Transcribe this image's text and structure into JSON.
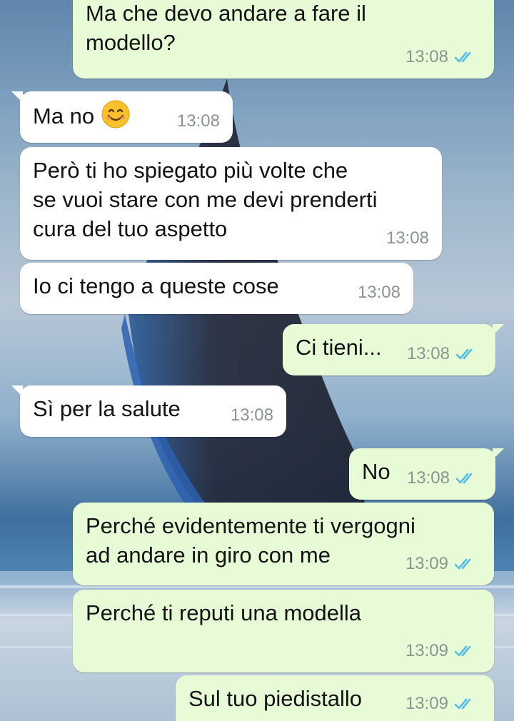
{
  "colors": {
    "outgoing_bubble": "#e7fcd6",
    "incoming_bubble": "#ffffff",
    "read_ticks": "#53bdeb",
    "time_text": "#8a958f"
  },
  "messages": [
    {
      "direction": "outgoing",
      "text": "Ma che devo andare a fare il\nmodello?",
      "time": "13:08",
      "status_icon": "double-check-read-icon"
    },
    {
      "direction": "incoming",
      "text": "Ma no",
      "emoji": "smiling-face-emoji",
      "time": "13:08"
    },
    {
      "direction": "incoming",
      "text": "Però ti ho spiegato più volte che\nse vuoi stare con me devi prenderti\ncura del tuo aspetto",
      "time": "13:08"
    },
    {
      "direction": "incoming",
      "text": "Io ci tengo a queste cose",
      "time": "13:08"
    },
    {
      "direction": "outgoing",
      "text": "Ci tieni...",
      "time": "13:08",
      "status_icon": "double-check-read-icon"
    },
    {
      "direction": "incoming",
      "text": "Sì per la salute",
      "time": "13:08"
    },
    {
      "direction": "outgoing",
      "text": "No",
      "time": "13:08",
      "status_icon": "double-check-read-icon"
    },
    {
      "direction": "outgoing",
      "text": "Perché evidentemente ti vergogni\nad andare in giro con me",
      "time": "13:09",
      "status_icon": "double-check-read-icon"
    },
    {
      "direction": "outgoing",
      "text": "Perché ti reputi una modella",
      "time": "13:09",
      "status_icon": "double-check-read-icon"
    },
    {
      "direction": "outgoing",
      "text": "Sul tuo piedistallo",
      "time": "13:09",
      "status_icon": "double-check-read-icon"
    }
  ]
}
